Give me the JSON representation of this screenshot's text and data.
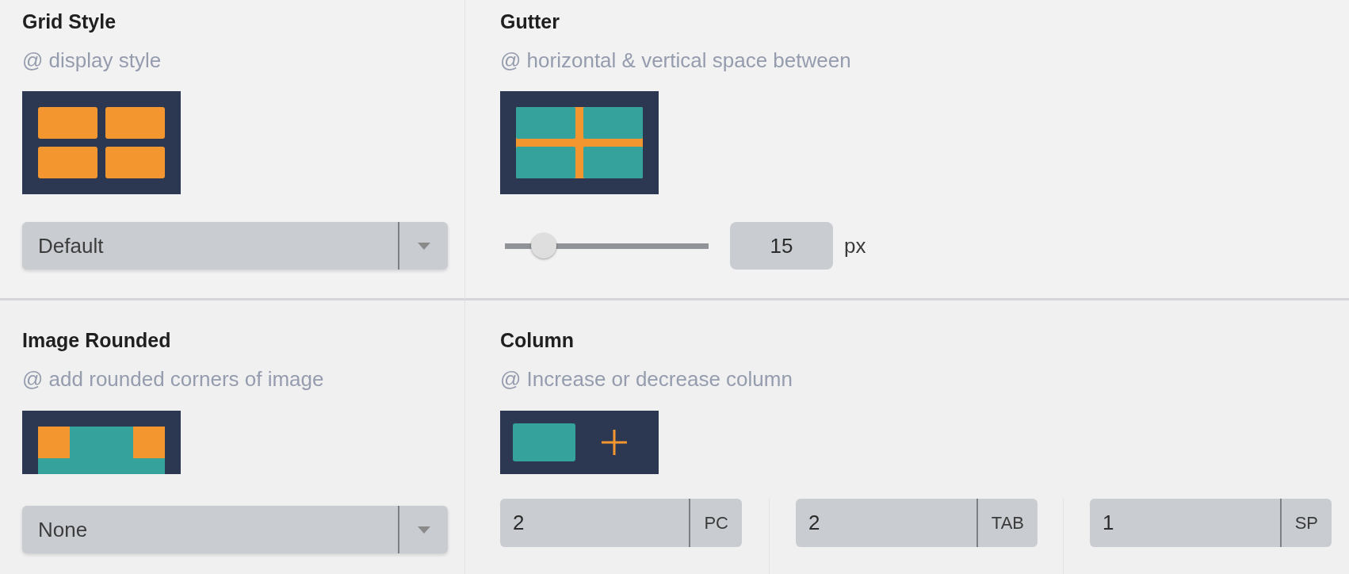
{
  "sections": [
    {
      "kind": "dropdown",
      "title": "Grid Style",
      "hint": "@ display style",
      "preview": {
        "kind": "grid"
      },
      "dropdown": {
        "value": "Default"
      }
    },
    {
      "kind": "slider",
      "title": "Gutter",
      "hint": "@ horizontal & vertical space between",
      "preview": {
        "kind": "gutter"
      },
      "slider": {
        "level": 0.19
      },
      "input": {
        "value": "15"
      },
      "unit": "px"
    },
    {
      "kind": "dropdown",
      "title": "Image Rounded",
      "hint": "@ add rounded corners of image",
      "preview": {
        "kind": "rounded"
      },
      "dropdown": {
        "value": "None"
      }
    },
    {
      "kind": "columns",
      "title": "Column",
      "hint": "@ Increase or decrease column",
      "preview": {
        "kind": "column"
      },
      "fields": [
        {
          "value": "2",
          "suffix": "PC"
        },
        {
          "value": "2",
          "suffix": "TAB"
        },
        {
          "value": "1",
          "suffix": "SP"
        }
      ]
    }
  ]
}
